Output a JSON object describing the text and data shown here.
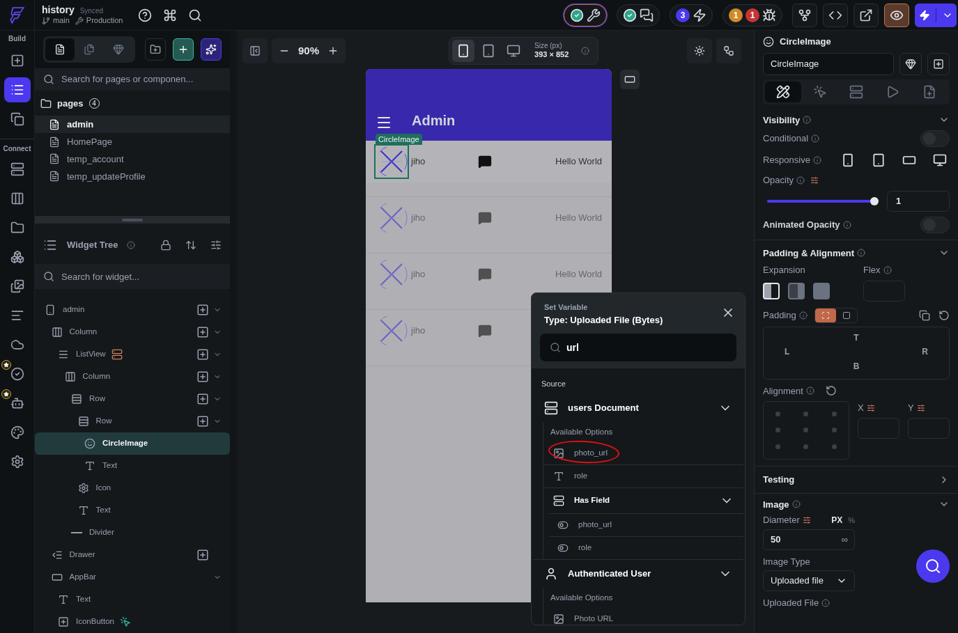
{
  "topbar": {
    "project": "history",
    "sync_status": "Synced",
    "branch": "main",
    "environment": "Production",
    "pills": [
      {
        "kind": "design",
        "ok": true
      },
      {
        "kind": "comments",
        "ok": true
      },
      {
        "kind": "actions",
        "count": "3"
      },
      {
        "kind": "bugs",
        "warnings": "1",
        "errors": "1"
      }
    ]
  },
  "rail": {
    "sections": [
      {
        "label": "Build",
        "items": [
          {
            "kind": "add_widget",
            "selected": false,
            "starred": false
          },
          {
            "kind": "tree",
            "selected": true,
            "starred": false
          },
          {
            "kind": "components",
            "selected": false,
            "starred": false
          }
        ]
      },
      {
        "label": "Connect",
        "items": [
          {
            "kind": "data",
            "selected": false,
            "starred": false
          },
          {
            "kind": "schema",
            "selected": false,
            "starred": false
          },
          {
            "kind": "storage",
            "selected": false,
            "starred": false
          },
          {
            "kind": "integrations",
            "selected": false,
            "starred": false
          },
          {
            "kind": "media",
            "selected": false,
            "starred": false
          },
          {
            "kind": "text",
            "selected": false,
            "starred": false
          },
          {
            "kind": "cloud",
            "selected": false,
            "starred": false
          },
          {
            "kind": "tests",
            "selected": false,
            "starred": true
          },
          {
            "kind": "agent",
            "selected": false,
            "starred": true
          },
          {
            "kind": "theme",
            "selected": false,
            "starred": false
          },
          {
            "kind": "settings",
            "selected": false,
            "starred": false
          }
        ]
      }
    ]
  },
  "left_panel": {
    "tabs": [
      {
        "kind": "pages",
        "selected": true
      },
      {
        "kind": "files",
        "selected": false
      },
      {
        "kind": "library",
        "selected": false
      }
    ],
    "search": {
      "placeholder": "Search for pages or componen..."
    },
    "pages": {
      "label": "pages",
      "count": "4",
      "items": [
        {
          "label": "admin",
          "selected": true
        },
        {
          "label": "HomePage",
          "selected": false
        },
        {
          "label": "temp_account",
          "selected": false
        },
        {
          "label": "temp_updateProfile",
          "selected": false
        }
      ]
    },
    "widget_tree": {
      "title": "Widget Tree",
      "search": {
        "placeholder": "Search for widget..."
      },
      "nodes": [
        {
          "label": "admin",
          "kind": "page",
          "add": true,
          "caret": true,
          "selected": false,
          "children": [
            {
              "label": "Column",
              "kind": "column",
              "add": true,
              "caret": true,
              "selected": false,
              "children": [
                {
                  "label": "ListView",
                  "kind": "listview",
                  "query": true,
                  "add": true,
                  "caret": true,
                  "selected": false,
                  "children": [
                    {
                      "label": "Column",
                      "kind": "column",
                      "add": true,
                      "caret": true,
                      "selected": false,
                      "children": [
                        {
                          "label": "Row",
                          "kind": "row",
                          "add": true,
                          "caret": true,
                          "selected": false,
                          "children": [
                            {
                              "label": "Row",
                              "kind": "row",
                              "add": true,
                              "caret": true,
                              "selected": false,
                              "children": [
                                {
                                  "label": "CircleImage",
                                  "kind": "image",
                                  "add": false,
                                  "caret": false,
                                  "selected": true
                                },
                                {
                                  "label": "Text",
                                  "kind": "text",
                                  "add": false,
                                  "caret": false,
                                  "selected": false
                                }
                              ]
                            },
                            {
                              "label": "Icon",
                              "kind": "icon",
                              "add": false,
                              "caret": false,
                              "selected": false
                            },
                            {
                              "label": "Text",
                              "kind": "text",
                              "add": false,
                              "caret": false,
                              "selected": false
                            }
                          ]
                        },
                        {
                          "label": "Divider",
                          "kind": "divider",
                          "add": false,
                          "caret": false,
                          "selected": false
                        }
                      ]
                    }
                  ]
                }
              ]
            },
            {
              "label": "Drawer",
              "kind": "drawer",
              "add": true,
              "caret": false,
              "selected": false
            },
            {
              "label": "AppBar",
              "kind": "appbar",
              "add": false,
              "caret": true,
              "selected": false,
              "children": [
                {
                  "label": "Text",
                  "kind": "text",
                  "add": false,
                  "caret": false,
                  "selected": false
                },
                {
                  "label": "IconButton",
                  "kind": "iconbutton",
                  "action": true,
                  "add": false,
                  "caret": false,
                  "selected": false
                }
              ]
            }
          ]
        }
      ]
    }
  },
  "canvas": {
    "zoom": "90%",
    "devices": [
      {
        "kind": "phone",
        "selected": true
      },
      {
        "kind": "tablet",
        "selected": false
      },
      {
        "kind": "desktop",
        "selected": false
      }
    ],
    "size_label": "Size (px)",
    "size": "393 × 852",
    "phone": {
      "title": "Admin",
      "selection_tag": "CircleImage",
      "rows": [
        {
          "name": "jiho",
          "text": "Hello World",
          "selected": true
        },
        {
          "name": "jiho",
          "text": "Hello World",
          "selected": false
        },
        {
          "name": "jiho",
          "text": "Hello World",
          "selected": false
        },
        {
          "name": "jiho",
          "selected": false
        }
      ]
    }
  },
  "popup": {
    "kicker": "Set Variable",
    "title": "Type: Uploaded File (Bytes)",
    "search_value": "url",
    "section": "Source",
    "groups": [
      {
        "title": "users Document",
        "kind": "document",
        "expanded": true,
        "options_label": "Available Options",
        "options": [
          {
            "label": "photo_url",
            "kind": "image",
            "circled": true
          },
          {
            "label": "role",
            "kind": "text",
            "circled": false
          }
        ],
        "sub": {
          "title": "Has Field",
          "expanded": true,
          "options": [
            {
              "label": "photo_url",
              "kind": "toggle"
            },
            {
              "label": "role",
              "kind": "toggle"
            }
          ]
        }
      },
      {
        "title": "Authenticated User",
        "kind": "user",
        "expanded": true,
        "options_label": "Available Options",
        "options": [
          {
            "label": "Photo URL",
            "kind": "image",
            "circled": false
          }
        ]
      }
    ]
  },
  "props": {
    "widget": "CircleImage",
    "name_value": "CircleImage",
    "tabs": [
      {
        "kind": "properties",
        "selected": true
      },
      {
        "kind": "actions",
        "selected": false
      },
      {
        "kind": "backend",
        "selected": false
      },
      {
        "kind": "animations",
        "selected": false
      },
      {
        "kind": "notes",
        "selected": false
      }
    ],
    "visibility": {
      "title": "Visibility",
      "conditional": {
        "label": "Conditional",
        "on": false
      },
      "responsive": {
        "label": "Responsive",
        "devices": [
          {
            "kind": "phone",
            "on": true
          },
          {
            "kind": "tablet",
            "on": true
          },
          {
            "kind": "tablet_landscape",
            "on": true
          },
          {
            "kind": "desktop",
            "on": true
          }
        ]
      },
      "opacity": {
        "label": "Opacity",
        "level": 1,
        "value": "1"
      },
      "animated": {
        "label": "Animated Opacity",
        "on": false
      }
    },
    "padding": {
      "title": "Padding & Alignment",
      "expansion_label": "Expansion",
      "expansion": [
        {
          "kind": "fixed",
          "selected": true
        },
        {
          "kind": "flexible",
          "selected": false
        },
        {
          "kind": "expanded",
          "selected": false
        }
      ],
      "flex_label": "Flex",
      "padding_label": "Padding",
      "modes": [
        {
          "kind": "each",
          "selected": true
        },
        {
          "kind": "all",
          "selected": false
        }
      ],
      "sides": {
        "top": "T",
        "left": "L",
        "right": "R",
        "bottom": "B"
      },
      "alignment_label": "Alignment",
      "x_label": "X",
      "y_label": "Y"
    },
    "testing": {
      "title": "Testing",
      "expanded": false
    },
    "image": {
      "title": "Image",
      "diameter_label": "Diameter",
      "unit_px": "PX",
      "unit_pct": "%",
      "diameter": "50",
      "infinity": "∞",
      "type_label": "Image Type",
      "type_value": "Uploaded file",
      "file_label": "Uploaded File"
    }
  }
}
